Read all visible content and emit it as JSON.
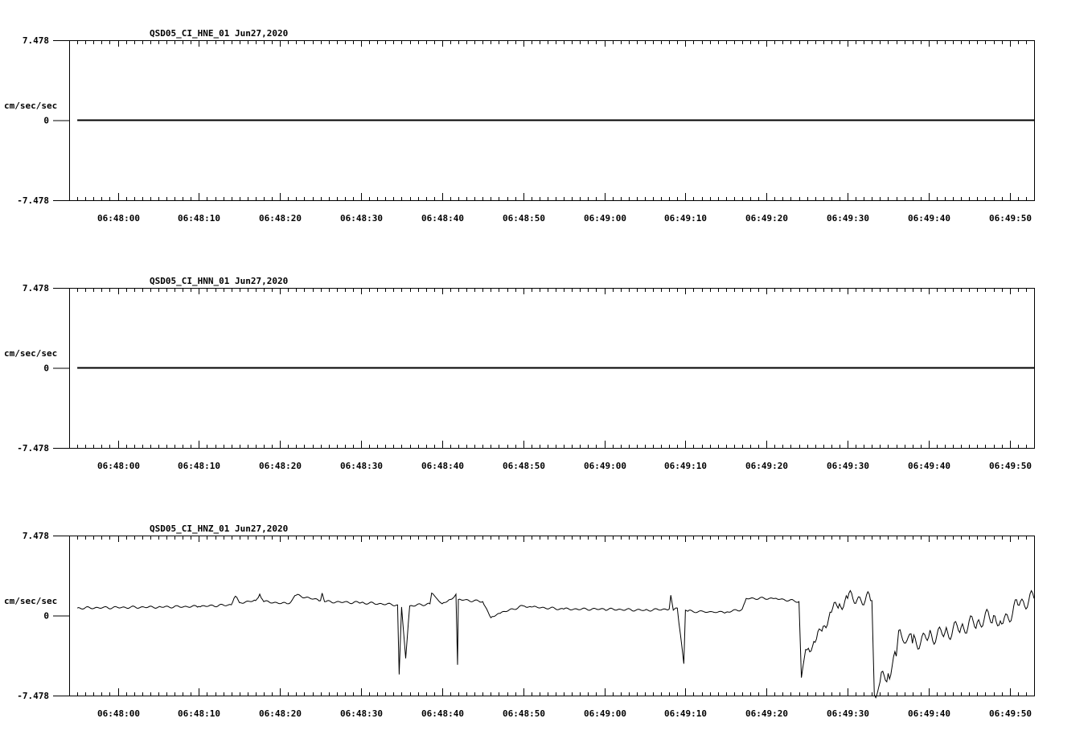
{
  "chart_data": [
    {
      "type": "line",
      "title": "QSD05_CI_HNE_01  Jun27,2020",
      "ylabel": "cm/sec/sec",
      "ylim": [
        -7.478,
        7.478
      ],
      "yticks": [
        "7.478",
        "0",
        "-7.478"
      ],
      "xlim": [
        "06:47:54",
        "06:49:53"
      ],
      "xticks": [
        "06:48:00",
        "06:48:10",
        "06:48:20",
        "06:48:30",
        "06:48:40",
        "06:48:50",
        "06:49:00",
        "06:49:10",
        "06:49:20",
        "06:49:30",
        "06:49:40",
        "06:49:50"
      ],
      "series": [
        {
          "x": [
            "06:47:55",
            "06:49:53"
          ],
          "y": [
            0,
            0
          ]
        }
      ]
    },
    {
      "type": "line",
      "title": "QSD05_CI_HNN_01  Jun27,2020",
      "ylabel": "cm/sec/sec",
      "ylim": [
        -7.478,
        7.478
      ],
      "yticks": [
        "7.478",
        "0",
        "-7.478"
      ],
      "xlim": [
        "06:47:54",
        "06:49:53"
      ],
      "xticks": [
        "06:48:00",
        "06:48:10",
        "06:48:20",
        "06:48:30",
        "06:48:40",
        "06:48:50",
        "06:49:00",
        "06:49:10",
        "06:49:20",
        "06:49:30",
        "06:49:40",
        "06:49:50"
      ],
      "series": [
        {
          "x": [
            "06:47:55",
            "06:49:53"
          ],
          "y": [
            0,
            0
          ]
        }
      ]
    },
    {
      "type": "line",
      "title": "QSD05_CI_HNZ_01  Jun27,2020",
      "ylabel": "cm/sec/sec",
      "ylim": [
        -7.478,
        7.478
      ],
      "yticks": [
        "7.478",
        "0",
        "-7.478"
      ],
      "xlim": [
        "06:47:54",
        "06:49:53"
      ],
      "xticks": [
        "06:48:00",
        "06:48:10",
        "06:48:20",
        "06:48:30",
        "06:48:40",
        "06:48:50",
        "06:49:00",
        "06:49:10",
        "06:49:20",
        "06:49:30",
        "06:49:40",
        "06:49:50"
      ],
      "series": [
        {
          "x": [
            "06:47:55",
            "06:48:05",
            "06:48:10",
            "06:48:14",
            "06:48:14.5",
            "06:48:15",
            "06:48:17",
            "06:48:17.5",
            "06:48:18",
            "06:48:21",
            "06:48:22",
            "06:48:25",
            "06:48:25.2",
            "06:48:25.5",
            "06:48:30",
            "06:48:34.5",
            "06:48:34.7",
            "06:48:35",
            "06:48:35.5",
            "06:48:36",
            "06:48:38.5",
            "06:48:38.7",
            "06:48:40",
            "06:48:41",
            "06:48:41.7",
            "06:48:41.9",
            "06:48:42",
            "06:48:45",
            "06:48:46",
            "06:48:47",
            "06:48:50",
            "06:48:51",
            "06:48:55",
            "06:49:00",
            "06:49:05",
            "06:49:08",
            "06:49:08.2",
            "06:49:08.5",
            "06:49:09",
            "06:49:09.8",
            "06:49:10",
            "06:49:10.3",
            "06:49:15",
            "06:49:17",
            "06:49:17.5",
            "06:49:21",
            "06:49:24",
            "06:49:24.3",
            "06:49:25",
            "06:49:26",
            "06:49:27",
            "06:49:28",
            "06:49:29",
            "06:49:30",
            "06:49:33",
            "06:49:33.3",
            "06:49:34",
            "06:49:35",
            "06:49:36",
            "06:49:36.3",
            "06:49:38",
            "06:49:40",
            "06:49:42",
            "06:49:44",
            "06:49:46",
            "06:49:48",
            "06:49:49",
            "06:49:51",
            "06:49:53"
          ],
          "y": [
            0.7,
            0.8,
            0.85,
            1.0,
            1.8,
            1.2,
            1.4,
            2.0,
            1.3,
            1.1,
            1.9,
            1.4,
            2.1,
            1.3,
            1.2,
            1.0,
            -5.5,
            0.8,
            -4.0,
            0.9,
            1.1,
            2.1,
            1.1,
            1.5,
            2.0,
            -4.6,
            1.5,
            1.3,
            -0.2,
            0.2,
            0.9,
            0.8,
            0.6,
            0.6,
            0.5,
            0.6,
            1.9,
            0.5,
            0.7,
            -4.5,
            0.5,
            0.4,
            0.3,
            0.6,
            1.6,
            1.6,
            1.3,
            -5.8,
            -3.2,
            -2.5,
            -1.0,
            0.3,
            1.1,
            1.6,
            1.4,
            -7.4,
            -6.2,
            -5.4,
            -3.8,
            -1.4,
            -2.6,
            -2.0,
            -1.6,
            -1.1,
            -0.6,
            0.0,
            -0.8,
            1.0,
            1.6
          ]
        }
      ]
    }
  ]
}
